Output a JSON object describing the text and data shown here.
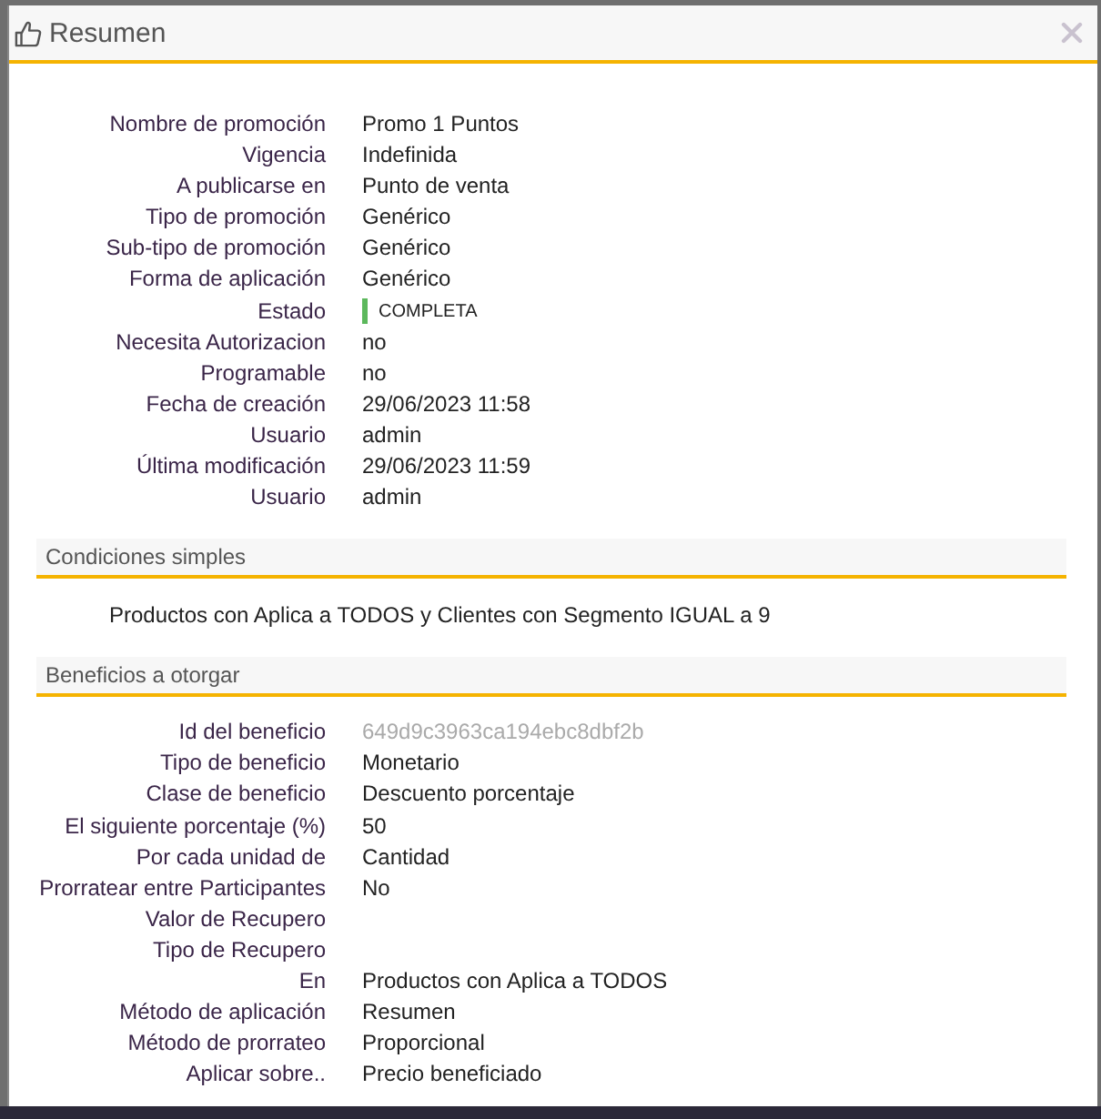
{
  "window": {
    "title": "Resumen"
  },
  "general": {
    "rows": [
      {
        "kind": "text",
        "label": "Nombre de promoción",
        "value": "Promo 1 Puntos"
      },
      {
        "kind": "text",
        "label": "Vigencia",
        "value": "Indefinida"
      },
      {
        "kind": "text",
        "label": "A publicarse en",
        "value": "Punto de venta"
      },
      {
        "kind": "text",
        "label": "Tipo de promoción",
        "value": "Genérico"
      },
      {
        "kind": "text",
        "label": "Sub-tipo de promoción",
        "value": "Genérico"
      },
      {
        "kind": "text",
        "label": "Forma de aplicación",
        "value": "Genérico"
      },
      {
        "kind": "status",
        "label": "Estado",
        "value": "COMPLETA"
      },
      {
        "kind": "text",
        "label": "Necesita Autorizacion",
        "value": "no"
      },
      {
        "kind": "text",
        "label": "Programable",
        "value": "no"
      },
      {
        "kind": "text",
        "label": "Fecha de creación",
        "value": "29/06/2023 11:58"
      },
      {
        "kind": "text",
        "label": "Usuario",
        "value": "admin"
      },
      {
        "kind": "text",
        "label": "Última modificación",
        "value": "29/06/2023 11:59"
      },
      {
        "kind": "text",
        "label": "Usuario",
        "value": "admin"
      }
    ]
  },
  "conditions": {
    "title": "Condiciones simples",
    "text": "Productos con Aplica a TODOS y Clientes con Segmento IGUAL a 9"
  },
  "benefits": {
    "title": "Beneficios a otorgar",
    "rows": [
      {
        "kind": "id",
        "label": "Id del beneficio",
        "value": "649d9c3963ca194ebc8dbf2b"
      },
      {
        "kind": "text",
        "label": "Tipo de beneficio",
        "value": "Monetario"
      },
      {
        "kind": "text",
        "label": "Clase de beneficio",
        "value": "Descuento porcentaje"
      },
      {
        "kind": "text",
        "label": "El siguiente porcentaje (%)",
        "value": "50"
      },
      {
        "kind": "text",
        "label": "Por cada unidad de",
        "value": "Cantidad"
      },
      {
        "kind": "text",
        "label": "Prorratear entre Participantes",
        "value": "No"
      },
      {
        "kind": "text",
        "label": "Valor de Recupero"
      },
      {
        "kind": "text",
        "label": "Tipo de Recupero"
      },
      {
        "kind": "text",
        "label": "En",
        "value": "Productos con Aplica a TODOS"
      },
      {
        "kind": "text",
        "label": "Método de aplicación",
        "value": "Resumen"
      },
      {
        "kind": "text",
        "label": "Método de prorrateo",
        "value": "Proporcional"
      },
      {
        "kind": "text",
        "label": "Aplicar sobre..",
        "value": "Precio beneficiado"
      }
    ]
  }
}
